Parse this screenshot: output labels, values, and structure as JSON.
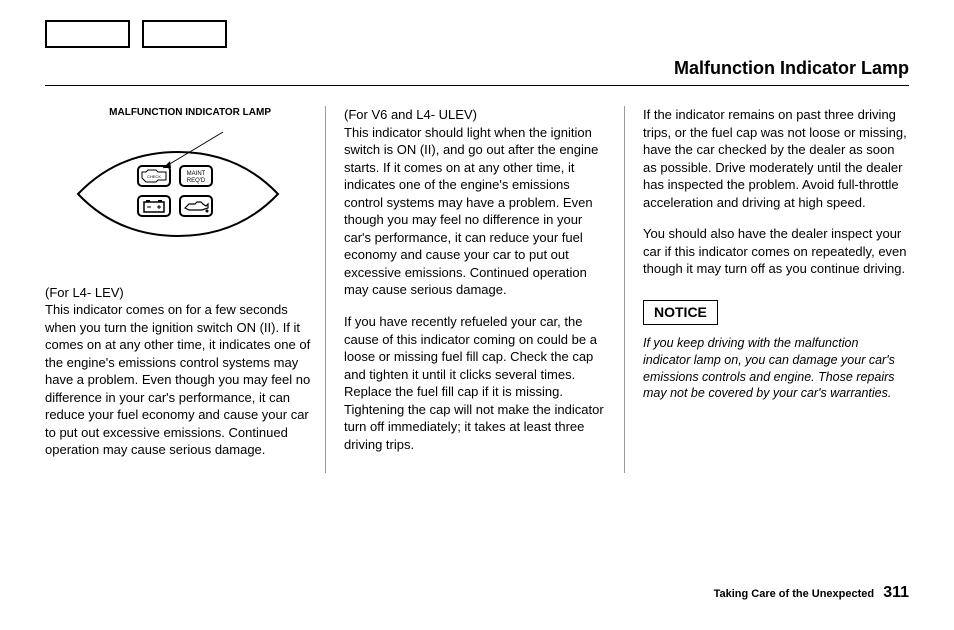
{
  "page_title": "Malfunction Indicator Lamp",
  "figure_caption": "MALFUNCTION INDICATOR LAMP",
  "column1": {
    "subhead": "(For L4- LEV)",
    "p1": "This indicator comes on for a few seconds when you turn the ignition switch ON (II). If it comes on at any other time, it indicates one of the engine's emissions control systems may have a problem. Even though you may feel no difference in your car's performance, it can reduce your fuel economy and cause your car to put out excessive emissions. Continued operation may cause serious damage."
  },
  "column2": {
    "subhead": "(For V6 and L4- ULEV)",
    "p1": "This indicator should light when the ignition switch is ON (II), and go out after the engine starts. If it comes on at any other time, it indicates one of the engine's emissions control systems may have a problem. Even though you may feel no difference in your car's performance, it can reduce your fuel economy and cause your car to put out excessive emissions. Continued operation may cause serious damage.",
    "p2": "If you have recently refueled your car, the cause of this indicator coming on could be a loose or missing fuel fill cap. Check the cap and tighten it until it clicks several times. Replace the fuel fill cap if it is missing. Tightening the cap will not make the indicator turn off immediately; it takes at least three driving trips."
  },
  "column3": {
    "p1": "If the indicator remains on past three driving trips, or the fuel cap was not loose or missing, have the car checked by the dealer as soon as possible. Drive moderately until the dealer has inspected the problem. Avoid full-throttle acceleration and driving at high speed.",
    "p2": "You should also have the dealer inspect your car if this indicator comes on repeatedly, even though it may turn off as you continue driving.",
    "notice_label": "NOTICE",
    "notice_text": "If you keep driving with the malfunction indicator lamp on, you can damage your car's emissions controls and engine. Those repairs may not be covered by your car's warranties."
  },
  "footer": {
    "section": "Taking Care of the Unexpected",
    "page": "311"
  }
}
